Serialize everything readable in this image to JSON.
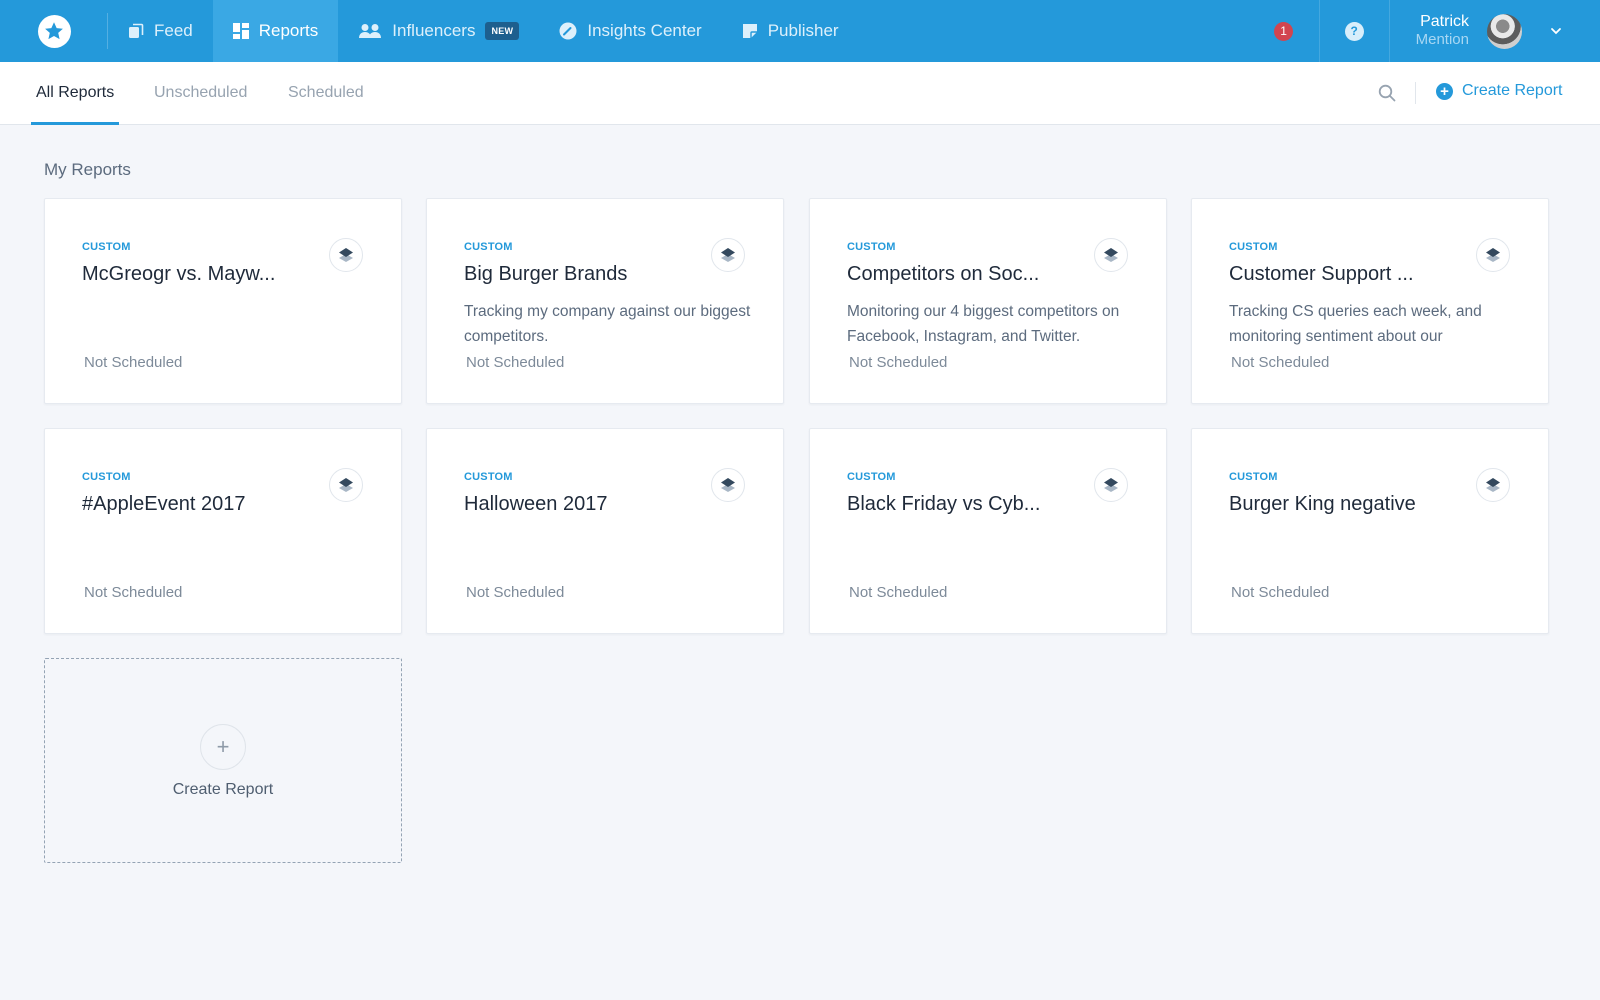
{
  "topnav": {
    "items": [
      {
        "label": "Feed",
        "icon": "feed-icon"
      },
      {
        "label": "Reports",
        "icon": "reports-icon",
        "active": true
      },
      {
        "label": "Influencers",
        "icon": "influencers-icon",
        "badge": "NEW"
      },
      {
        "label": "Insights Center",
        "icon": "gauge-icon"
      },
      {
        "label": "Publisher",
        "icon": "publisher-icon"
      }
    ],
    "notifications_count": "1",
    "help_label": "?",
    "user": {
      "name": "Patrick",
      "org": "Mention"
    }
  },
  "subnav": {
    "tabs": [
      {
        "label": "All Reports",
        "active": true
      },
      {
        "label": "Unscheduled"
      },
      {
        "label": "Scheduled"
      }
    ],
    "create_label": "Create Report"
  },
  "section_title": "My Reports",
  "reports": [
    {
      "type": "CUSTOM",
      "title": "McGreogr vs. Mayw...",
      "description": "",
      "status": "Not Scheduled"
    },
    {
      "type": "CUSTOM",
      "title": "Big Burger Brands",
      "description": "Tracking my company against our biggest competitors.",
      "status": "Not Scheduled"
    },
    {
      "type": "CUSTOM",
      "title": "Competitors on Soc...",
      "description": "Monitoring our 4 biggest competitors on Facebook, Instagram, and Twitter.",
      "status": "Not Scheduled"
    },
    {
      "type": "CUSTOM",
      "title": "Customer Support ...",
      "description": "Tracking CS queries each week, and monitoring sentiment about our",
      "status": "Not Scheduled"
    },
    {
      "type": "CUSTOM",
      "title": "#AppleEvent 2017",
      "description": "",
      "status": "Not Scheduled"
    },
    {
      "type": "CUSTOM",
      "title": "Halloween 2017",
      "description": "",
      "status": "Not Scheduled"
    },
    {
      "type": "CUSTOM",
      "title": "Black Friday vs Cyb...",
      "description": "",
      "status": "Not Scheduled"
    },
    {
      "type": "CUSTOM",
      "title": "Burger King negative",
      "description": "",
      "status": "Not Scheduled"
    }
  ],
  "add_card": {
    "plus": "+",
    "label": "Create Report"
  },
  "colors": {
    "brand": "#2499da",
    "notification": "#d2454f",
    "badge_new": "#1d5f8e"
  }
}
